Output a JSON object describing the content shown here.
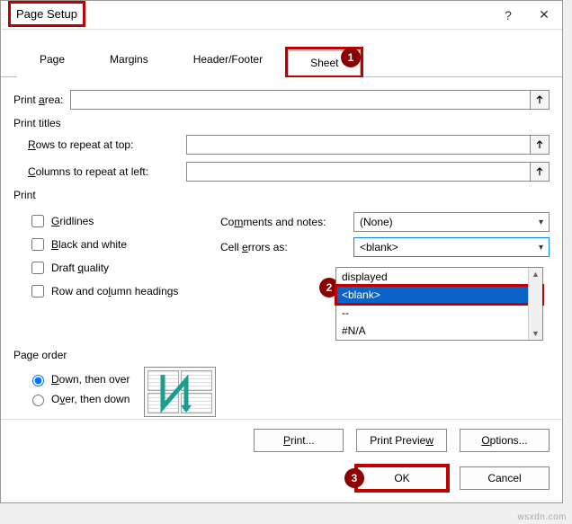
{
  "window": {
    "title": "Page Setup",
    "help": "?",
    "close": "✕"
  },
  "tabs": {
    "page": "Page",
    "margins": "Margins",
    "headerfooter": "Header/Footer",
    "sheet": "Sheet"
  },
  "badges": {
    "one": "1",
    "two": "2",
    "three": "3"
  },
  "labels": {
    "print_area": "Print area:",
    "print_titles": "Print titles",
    "rows_repeat": "Rows to repeat at top:",
    "cols_repeat": "Columns to repeat at left:",
    "print": "Print",
    "gridlines": "Gridlines",
    "bw": "Black and white",
    "draft": "Draft quality",
    "rowcolhead": "Row and column headings",
    "comments": "Comments and notes:",
    "cellerrors": "Cell errors as:",
    "page_order": "Page order",
    "down_over": "Down, then over",
    "over_down": "Over, then down"
  },
  "values": {
    "print_area": "",
    "rows_repeat": "",
    "cols_repeat": "",
    "comments_sel": "(None)",
    "cellerrors_sel": "<blank>"
  },
  "dropdown": {
    "opt_displayed": "displayed",
    "opt_blank": "<blank>",
    "opt_dashes": "--",
    "opt_na": "#N/A"
  },
  "buttons": {
    "print": "Print...",
    "preview": "Print Preview",
    "options": "Options...",
    "ok": "OK",
    "cancel": "Cancel"
  },
  "watermark": "wsxdn.com"
}
